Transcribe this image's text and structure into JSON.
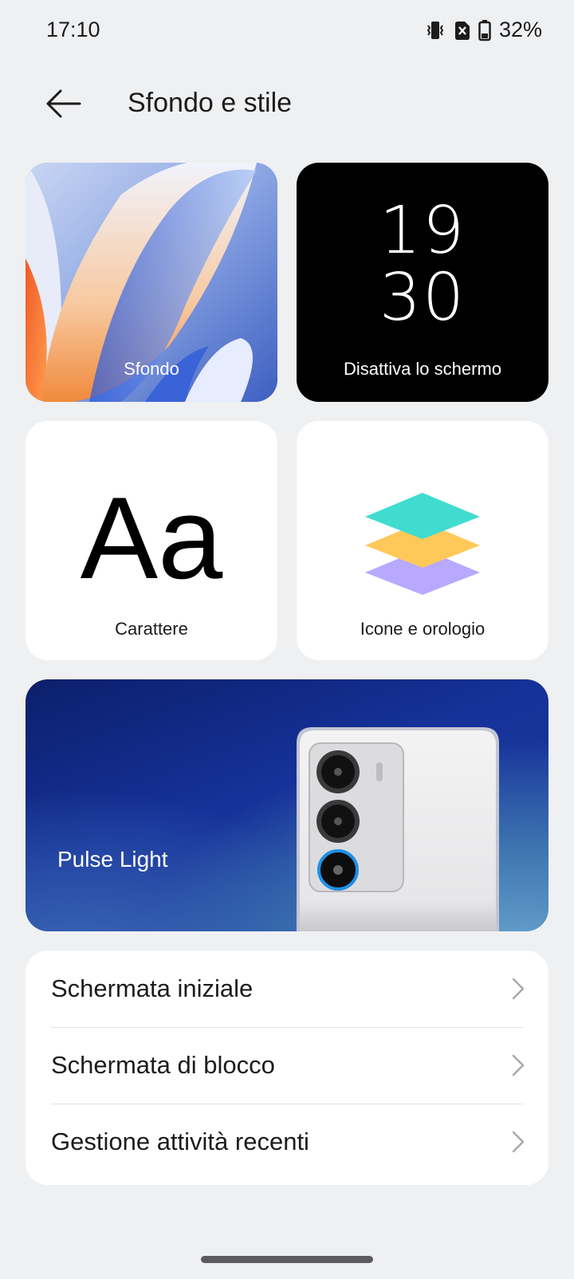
{
  "status_bar": {
    "time": "17:10",
    "battery_percent": "32%",
    "icons": [
      "vibrate-icon",
      "no-sim-icon",
      "battery-icon"
    ]
  },
  "header": {
    "title": "Sfondo e stile",
    "back_icon": "arrow-left-icon"
  },
  "tiles": {
    "wallpaper": {
      "label": "Sfondo"
    },
    "aod": {
      "label": "Disattiva lo schermo",
      "clock_hour": "19",
      "clock_minute": "30"
    },
    "font": {
      "label": "Carattere",
      "sample": "Aa"
    },
    "icons": {
      "label": "Icone e orologio",
      "layer_colors": [
        "#40dcd0",
        "#ffc95a",
        "#b8a9ff"
      ]
    },
    "pulse_light": {
      "label": "Pulse Light"
    }
  },
  "settings_list": [
    {
      "label": "Schermata iniziale"
    },
    {
      "label": "Schermata di blocco"
    },
    {
      "label": "Gestione attività recenti"
    }
  ],
  "colors": {
    "background": "#eff0f2",
    "card": "#ffffff",
    "pulse_ring": "#1e90e6"
  }
}
